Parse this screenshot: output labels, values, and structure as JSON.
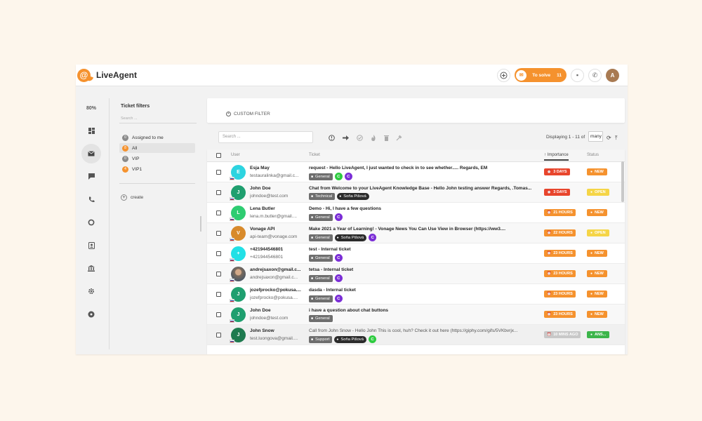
{
  "header": {
    "logo_text": "LiveAgent",
    "to_solve_label": "To solve",
    "to_solve_count": "11",
    "avatar_initial": "A"
  },
  "nav": {
    "zoom": "80%",
    "items": [
      "dashboard-icon",
      "email-icon",
      "chat-icon",
      "phone-icon",
      "reports-icon",
      "contacts-icon",
      "knowledgebase-icon",
      "settings-icon",
      "plugins-icon"
    ]
  },
  "filters": {
    "title": "Ticket filters",
    "search_placeholder": "Search ...",
    "items": [
      {
        "badge": "0",
        "label": "Assigned to me",
        "color": "#8a8a8a"
      },
      {
        "badge": "8",
        "label": "All",
        "color": "#f5922e"
      },
      {
        "badge": "0",
        "label": "VIP",
        "color": "#8a8a8a"
      },
      {
        "badge": "4",
        "label": "VIP1",
        "color": "#f5922e"
      }
    ],
    "create_label": "create"
  },
  "main": {
    "custom_filter_label": "CUSTOM FILTER",
    "search_placeholder": "Search ...",
    "displaying": "Displaying 1 - 11 of",
    "many": "many"
  },
  "table": {
    "headers": {
      "user": "User",
      "ticket": "Ticket",
      "importance": "Importance",
      "status": "Status"
    },
    "rows": [
      {
        "initial": "E",
        "avatar_color": "#2dd4e0",
        "name": "Esja May",
        "email": "testauralinka@gmail.c...",
        "subject": "request - Hello LiveAgent, I just wanted to check in to see whether..... Regards, EM",
        "bold": true,
        "tags": [
          {
            "kind": "folder",
            "text": "General"
          },
          {
            "kind": "letter",
            "text": "C",
            "color": "#2ecc40"
          },
          {
            "kind": "letter",
            "text": "C",
            "color": "#7b2ed6"
          }
        ],
        "importance": "3 DAYS",
        "importance_color": "#e8452c",
        "status": "NEW",
        "status_color": "#f5922e"
      },
      {
        "initial": "J",
        "avatar_color": "#1f9f6f",
        "name": "John Doe",
        "email": "johndoe@test.com",
        "subject": "Chat from Welcome to your LiveAgent Knowledge Base - Hello John testing answer Regards, .Tomas...",
        "bold": true,
        "tags": [
          {
            "kind": "folder",
            "text": "Technical"
          },
          {
            "kind": "agent",
            "text": "Soňa Pišová"
          }
        ],
        "importance": "3 DAYS",
        "importance_color": "#e8452c",
        "status": "OPEN",
        "status_color": "#f5d547"
      },
      {
        "initial": "L",
        "avatar_color": "#2ecc71",
        "name": "Lena Butler",
        "email": "lena.m.butler@gmail....",
        "subject": "Demo - Hi, I have a few questions",
        "bold": true,
        "tags": [
          {
            "kind": "folder",
            "text": "General"
          },
          {
            "kind": "letter",
            "text": "C",
            "color": "#7b2ed6"
          }
        ],
        "importance": "21 HOURS",
        "importance_color": "#f5922e",
        "status": "NEW",
        "status_color": "#f5922e"
      },
      {
        "initial": "V",
        "avatar_color": "#d88a2b",
        "name": "Vonage API",
        "email": "api-team@vonage.com",
        "subject": "Make 2021 a Year of Learning! -              Vonage News You Can Use View in Browser (https://ww3....",
        "bold": true,
        "tags": [
          {
            "kind": "folder",
            "text": "General"
          },
          {
            "kind": "agent",
            "text": "Soňa Pišová"
          },
          {
            "kind": "letter",
            "text": "C",
            "color": "#7b2ed6"
          }
        ],
        "importance": "22 HOURS",
        "importance_color": "#f5922e",
        "status": "OPEN",
        "status_color": "#f5d547"
      },
      {
        "initial": "+",
        "avatar_color": "#22e0e6",
        "name": "+421944546801",
        "email": "+421944546801",
        "subject": "test - Internal ticket",
        "bold": true,
        "tags": [
          {
            "kind": "folder",
            "text": "General"
          },
          {
            "kind": "letter",
            "text": "C",
            "color": "#7b2ed6"
          }
        ],
        "importance": "23 HOURS",
        "importance_color": "#f5922e",
        "status": "NEW",
        "status_color": "#f5922e"
      },
      {
        "initial": "",
        "avatar_color": "#6b7280",
        "photo": true,
        "name": "andrejsaxon@gmail.c...",
        "email": "andrejsaxon@gmail.c...",
        "subject": "tetsa - Internal ticket",
        "bold": true,
        "tags": [
          {
            "kind": "folder",
            "text": "General"
          },
          {
            "kind": "letter",
            "text": "C",
            "color": "#7b2ed6"
          }
        ],
        "importance": "23 HOURS",
        "importance_color": "#f5922e",
        "status": "NEW",
        "status_color": "#f5922e"
      },
      {
        "initial": "J",
        "avatar_color": "#1f9f6f",
        "name": "jozefprocko@pokusa....",
        "email": "jozefprocko@pokusa....",
        "subject": "dasda - Internal ticket",
        "bold": true,
        "tags": [
          {
            "kind": "folder",
            "text": "General"
          },
          {
            "kind": "letter",
            "text": "C",
            "color": "#7b2ed6"
          }
        ],
        "importance": "23 HOURS",
        "importance_color": "#f5922e",
        "status": "NEW",
        "status_color": "#f5922e"
      },
      {
        "initial": "J",
        "avatar_color": "#1f9f6f",
        "name": "John Doe",
        "email": "johndoe@test.com",
        "subject": "i have a question about chat buttons",
        "bold": true,
        "tags": [
          {
            "kind": "folder",
            "text": "General"
          }
        ],
        "importance": "23 HOURS",
        "importance_color": "#f5922e",
        "status": "NEW",
        "status_color": "#f5922e"
      },
      {
        "initial": "J",
        "avatar_color": "#1e7a4f",
        "name": "John Snow",
        "email": "test.luongova@gmail....",
        "subject": "Call from John Snow - Hello John This is cool, huh? Check it out here (https://giphy.com/gifs/5VKbvrjx...",
        "bold": false,
        "tags": [
          {
            "kind": "folder",
            "text": "Support"
          },
          {
            "kind": "agent",
            "text": "Soňa Pišová"
          },
          {
            "kind": "letter",
            "text": "C",
            "color": "#2ecc40"
          }
        ],
        "importance": "10 MINS AGO",
        "importance_color": "#c8c8c8",
        "status": "ANS...",
        "status_color": "#3cb54a"
      }
    ]
  }
}
